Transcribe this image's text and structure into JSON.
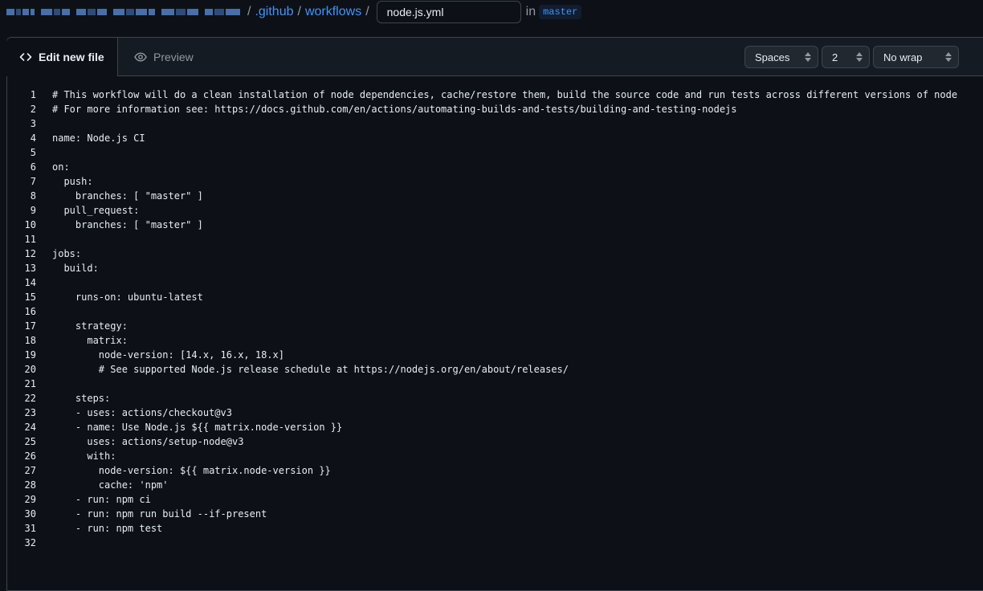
{
  "breadcrumb": {
    "github_folder": ".github",
    "workflows_folder": "workflows",
    "separator": "/",
    "filename_value": "node.js.yml",
    "in_label": "in",
    "branch": "master"
  },
  "tabs": {
    "edit": "Edit new file",
    "preview": "Preview"
  },
  "controls": {
    "indent_mode": "Spaces",
    "indent_size": "2",
    "wrap_mode": "No wrap"
  },
  "code_lines": [
    "# This workflow will do a clean installation of node dependencies, cache/restore them, build the source code and run tests across different versions of node",
    "# For more information see: https://docs.github.com/en/actions/automating-builds-and-tests/building-and-testing-nodejs",
    "",
    "name: Node.js CI",
    "",
    "on:",
    "  push:",
    "    branches: [ \"master\" ]",
    "  pull_request:",
    "    branches: [ \"master\" ]",
    "",
    "jobs:",
    "  build:",
    "",
    "    runs-on: ubuntu-latest",
    "",
    "    strategy:",
    "      matrix:",
    "        node-version: [14.x, 16.x, 18.x]",
    "        # See supported Node.js release schedule at https://nodejs.org/en/about/releases/",
    "",
    "    steps:",
    "    - uses: actions/checkout@v3",
    "    - name: Use Node.js ${{ matrix.node-version }}",
    "      uses: actions/setup-node@v3",
    "      with:",
    "        node-version: ${{ matrix.node-version }}",
    "        cache: 'npm'",
    "    - run: npm ci",
    "    - run: npm run build --if-present",
    "    - run: npm test",
    ""
  ]
}
